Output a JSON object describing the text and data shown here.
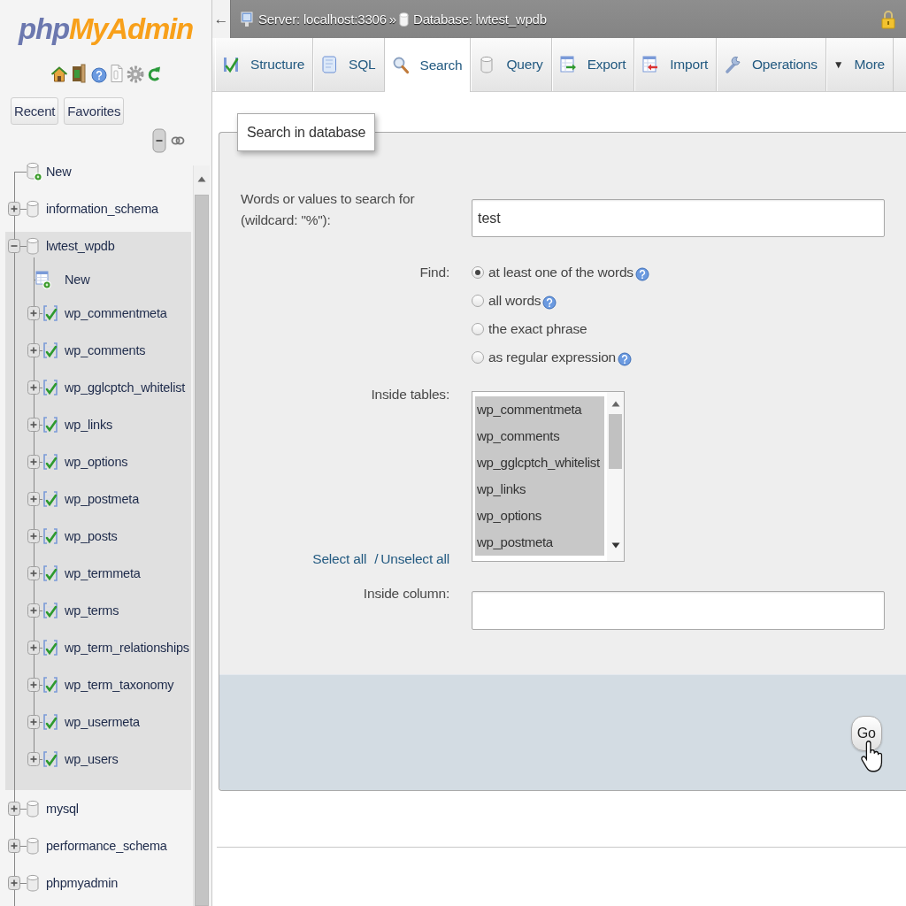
{
  "sidebar": {
    "logo": {
      "prefix": "php",
      "name": "MyAdmin"
    },
    "buttons": [
      "Recent",
      "Favorites"
    ],
    "tree": [
      {
        "label": "New",
        "kind": "new",
        "selected": false
      },
      {
        "label": "information_schema",
        "kind": "database",
        "expanded": false,
        "selected": false
      },
      {
        "label": "lwtest_wpdb",
        "kind": "database",
        "expanded": true,
        "selected": true,
        "children": [
          {
            "label": "New",
            "kind": "new"
          },
          {
            "label": "wp_commentmeta",
            "kind": "table",
            "expanded": false
          },
          {
            "label": "wp_comments",
            "kind": "table",
            "expanded": false
          },
          {
            "label": "wp_gglcptch_whitelist",
            "kind": "table",
            "expanded": false
          },
          {
            "label": "wp_links",
            "kind": "table",
            "expanded": false
          },
          {
            "label": "wp_options",
            "kind": "table",
            "expanded": false
          },
          {
            "label": "wp_postmeta",
            "kind": "table",
            "expanded": false
          },
          {
            "label": "wp_posts",
            "kind": "table",
            "expanded": false
          },
          {
            "label": "wp_termmeta",
            "kind": "table",
            "expanded": false
          },
          {
            "label": "wp_terms",
            "kind": "table",
            "expanded": false
          },
          {
            "label": "wp_term_relationships",
            "kind": "table",
            "expanded": false
          },
          {
            "label": "wp_term_taxonomy",
            "kind": "table",
            "expanded": false
          },
          {
            "label": "wp_usermeta",
            "kind": "table",
            "expanded": false
          },
          {
            "label": "wp_users",
            "kind": "table",
            "expanded": false
          }
        ]
      },
      {
        "label": "mysql",
        "kind": "database",
        "expanded": false,
        "selected": false
      },
      {
        "label": "performance_schema",
        "kind": "database",
        "expanded": false,
        "selected": false
      },
      {
        "label": "phpmyadmin",
        "kind": "database",
        "expanded": false,
        "selected": false
      }
    ]
  },
  "top_bar": {
    "back": "←",
    "server": "Server: localhost:3306",
    "separator": "»",
    "database": "Database: lwtest_wpdb"
  },
  "tabs": [
    {
      "label": "Structure",
      "kind": "structure",
      "selected": false
    },
    {
      "label": "SQL",
      "kind": "sql",
      "selected": false
    },
    {
      "label": "Search",
      "kind": "search",
      "selected": true
    },
    {
      "label": "Query",
      "kind": "query",
      "selected": false
    },
    {
      "label": "Export",
      "kind": "export",
      "selected": false
    },
    {
      "label": "Import",
      "kind": "import",
      "selected": false
    },
    {
      "label": "Operations",
      "kind": "operations",
      "selected": false
    },
    {
      "label": "More",
      "kind": "menu",
      "caret": "▼",
      "selected": false
    }
  ],
  "search_form": {
    "legend": "Search in database",
    "search_label": "Words or values to search for (wildcard: \"%\"):",
    "search_value": "test",
    "find_label": "Find:",
    "find_options": [
      {
        "label": "at least one of the words",
        "selected": true,
        "help": true
      },
      {
        "label": "all words",
        "selected": false,
        "help": true
      },
      {
        "label": "the exact phrase",
        "selected": false,
        "help": false
      },
      {
        "label": "as regular expression",
        "selected": false,
        "help": true
      }
    ],
    "tables_label": "Inside tables:",
    "tables": [
      {
        "label": "wp_commentmeta",
        "selected": true
      },
      {
        "label": "wp_comments",
        "selected": true
      },
      {
        "label": "wp_gglcptch_whitelist",
        "selected": true
      },
      {
        "label": "wp_links",
        "selected": true
      },
      {
        "label": "wp_options",
        "selected": true
      },
      {
        "label": "wp_postmeta",
        "selected": true
      }
    ],
    "select_all": "Select all",
    "link_separator": "/",
    "unselect_all": "Unselect all",
    "column_label": "Inside column:",
    "go_button": "Go"
  }
}
